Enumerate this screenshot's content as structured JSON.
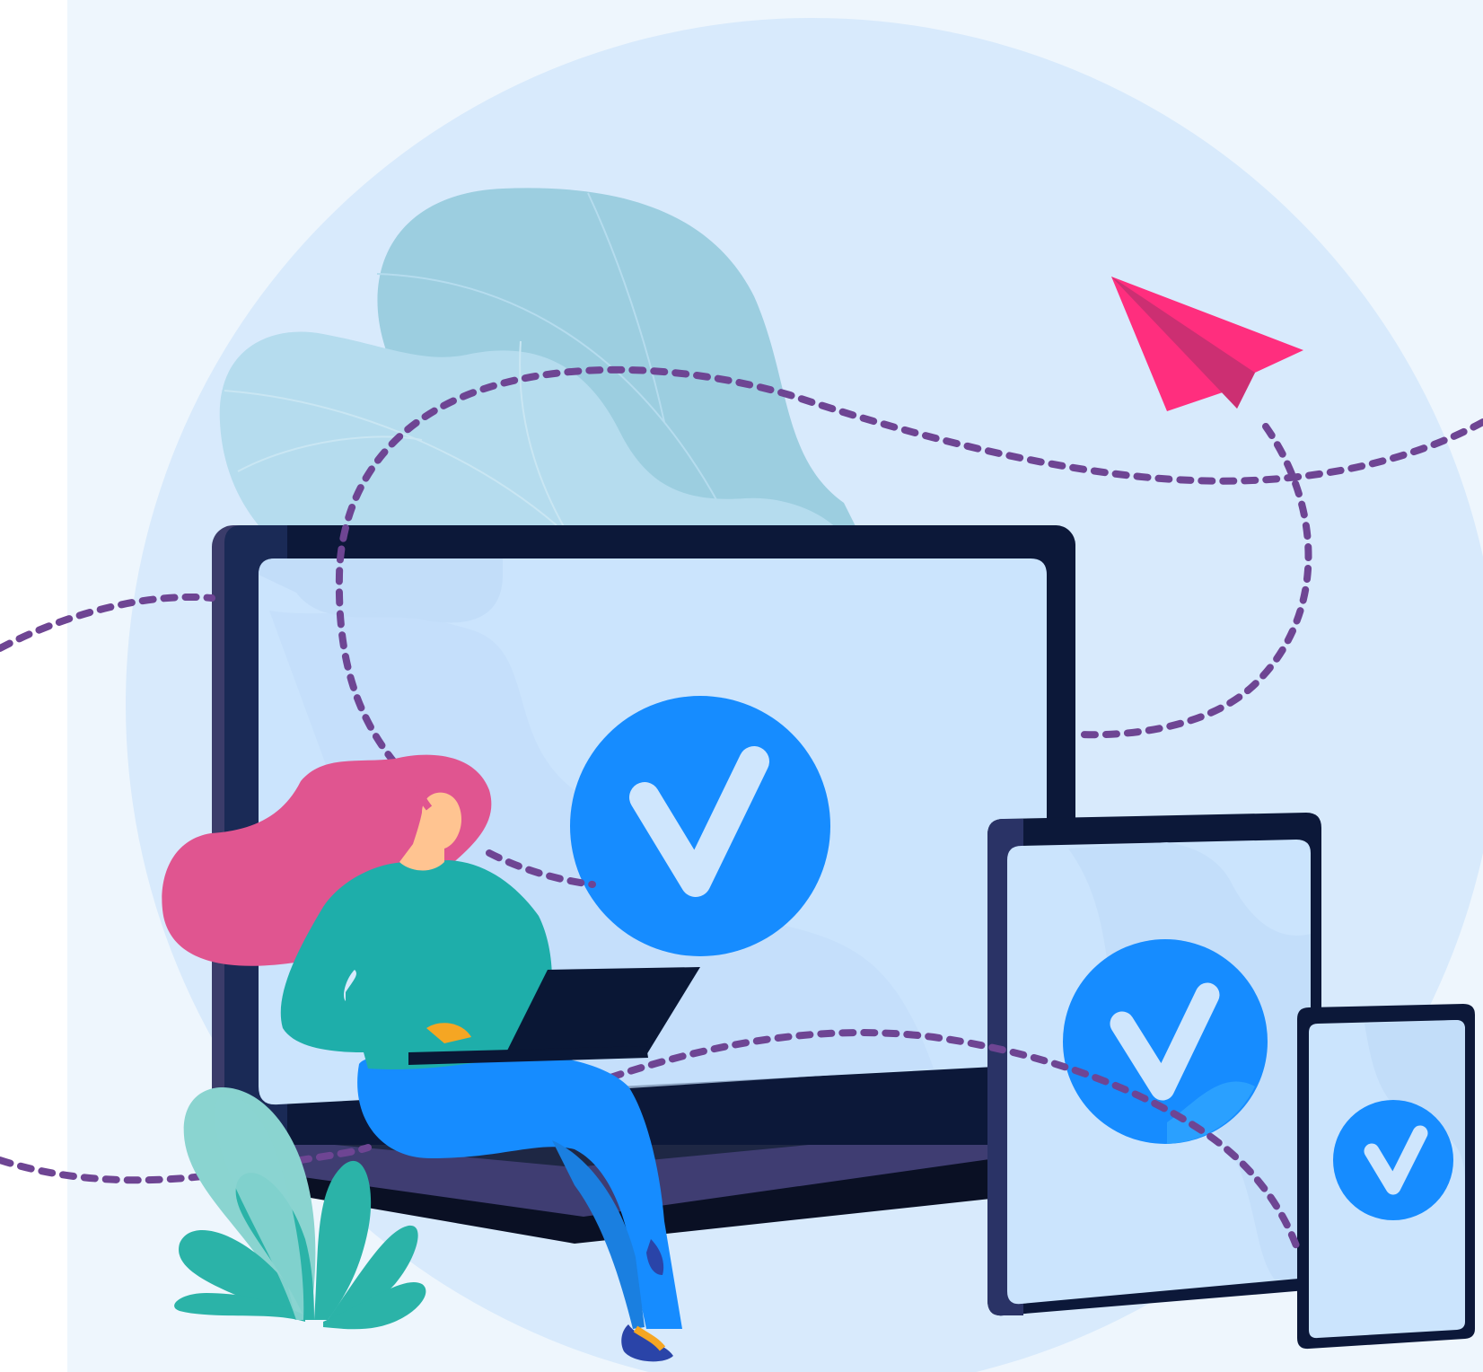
{
  "scene": {
    "colors": {
      "page": "#ffffff",
      "panel": "#eef6fd",
      "circle": "#d8eafc",
      "leaf_light": "#b5dcee",
      "leaf_dark": "#9ccee0",
      "device_frame": "#0c1839",
      "device_frame_side": "#3b3c6a",
      "screen": "#cbe4fd",
      "screen_shade": "#c2ddf9",
      "badge": "#168cff",
      "badge_alt": "#2aa0ff",
      "check": "#cfe6fd",
      "dashed_path": "#6e4593",
      "paper_plane": "#ff2e7e",
      "paper_plane_fold": "#cc2f72",
      "hair": "#e05590",
      "skin": "#ffc491",
      "sweater": "#1eaeaa",
      "trousers": "#168cff",
      "shoes": "#2a44a8",
      "plant_dark": "#2bb3a8",
      "plant_light": "#8ad4d0"
    },
    "icons": [
      "check-badge-icon",
      "paper-plane-icon",
      "plant-icon",
      "leaf-icon"
    ]
  }
}
